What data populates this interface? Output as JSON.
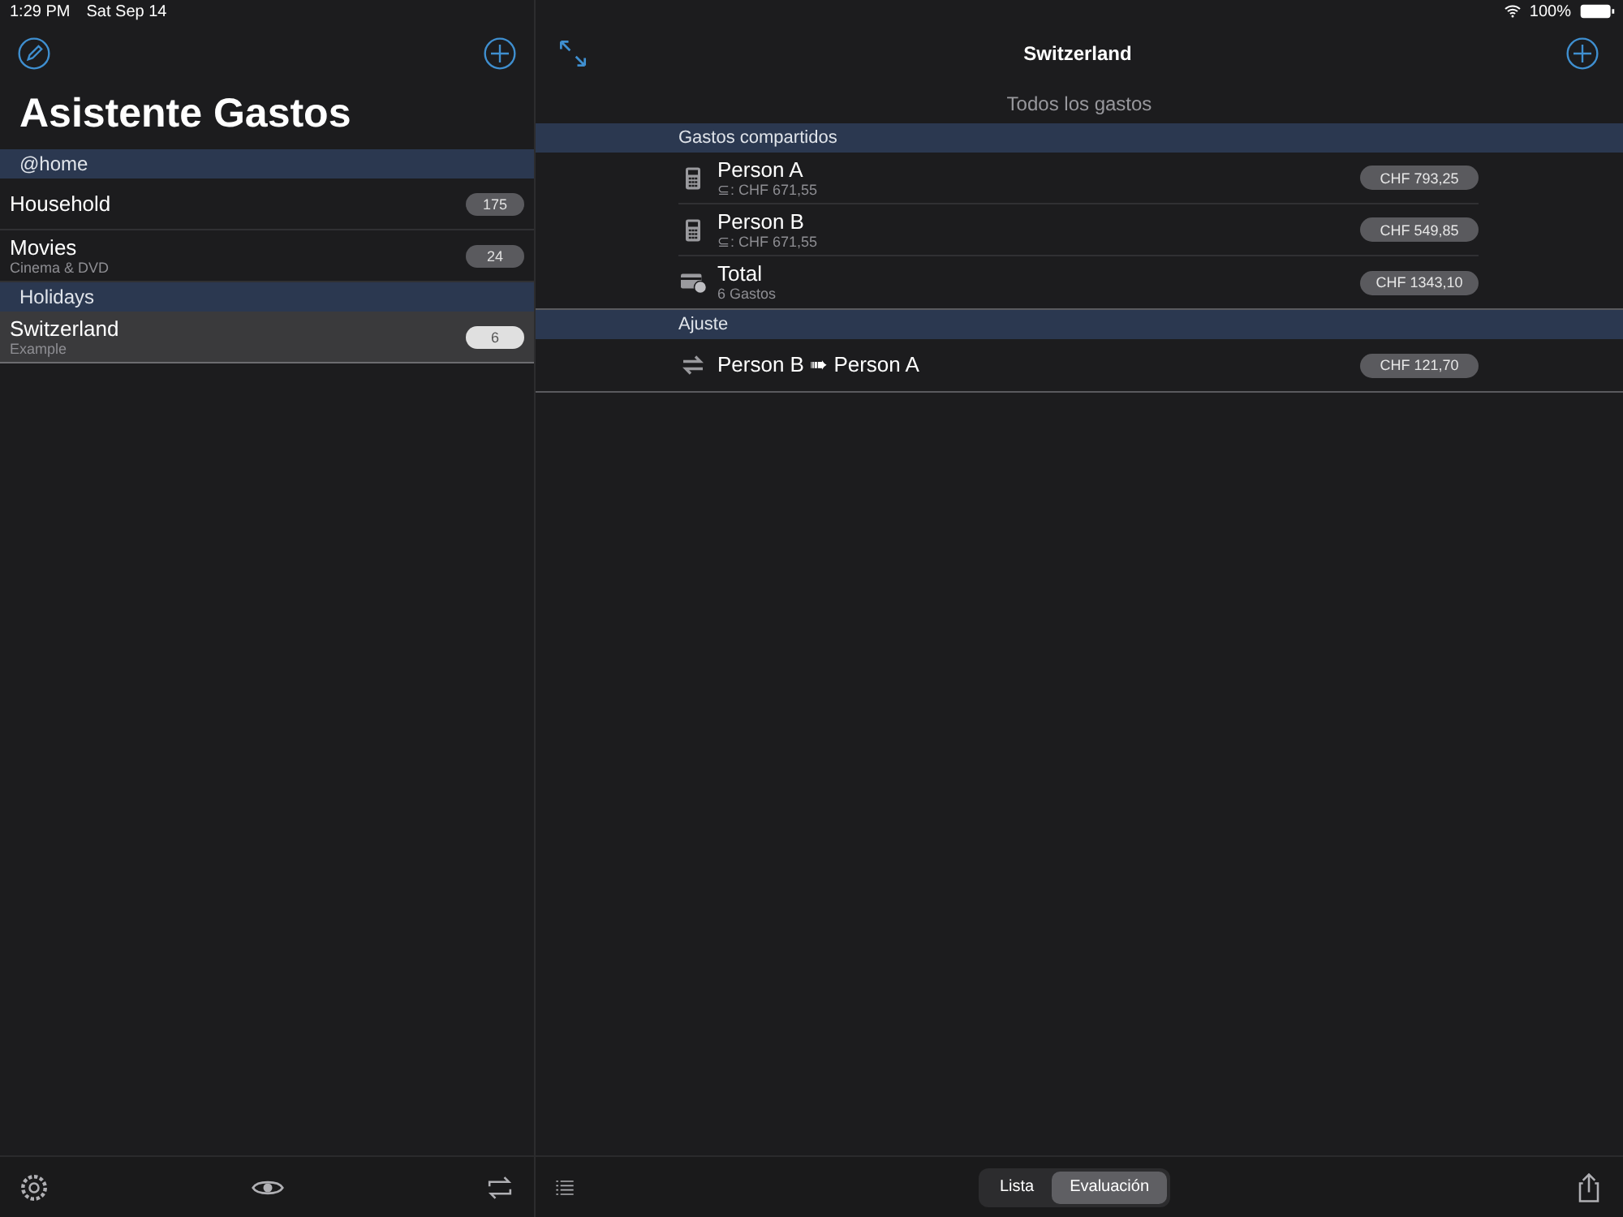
{
  "status_bar": {
    "time": "1:29 PM",
    "date": "Sat Sep 14",
    "battery": "100%"
  },
  "sidebar": {
    "title": "Asistente Gastos",
    "sections": [
      {
        "header": "@home",
        "items": [
          {
            "name": "Household",
            "count": "175",
            "selected": false
          },
          {
            "name": "Movies",
            "subtitle": "Cinema & DVD",
            "count": "24",
            "selected": false
          }
        ]
      },
      {
        "header": "Holidays",
        "items": [
          {
            "name": "Switzerland",
            "subtitle": "Example",
            "count": "6",
            "selected": true
          }
        ]
      }
    ]
  },
  "detail": {
    "title": "Switzerland",
    "subtitle": "Todos los gastos",
    "sections": [
      {
        "header": "Gastos compartidos",
        "rows": [
          {
            "kind": "person",
            "name": "Person A",
            "detail": "⊆: CHF 671,55",
            "amount": "CHF 793,25"
          },
          {
            "kind": "person",
            "name": "Person B",
            "detail": "⊆: CHF 671,55",
            "amount": "CHF 549,85"
          },
          {
            "kind": "total",
            "name": "Total",
            "detail": "6 Gastos",
            "amount": "CHF 1343,10"
          }
        ]
      },
      {
        "header": "Ajuste",
        "rows": [
          {
            "kind": "transfer",
            "name": "Person B ➠ Person A",
            "amount": "CHF 121,70"
          }
        ]
      }
    ]
  },
  "segments": [
    {
      "label": "Lista",
      "selected": false
    },
    {
      "label": "Evaluación",
      "selected": true
    }
  ]
}
